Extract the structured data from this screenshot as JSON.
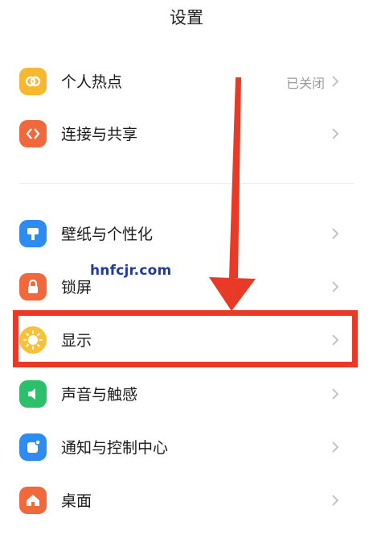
{
  "header": {
    "title": "设置"
  },
  "items": [
    {
      "label": "个人热点",
      "value": "已关闭",
      "icon": "hotspot-icon",
      "color": "#F7B731"
    },
    {
      "label": "连接与共享",
      "icon": "share-icon",
      "color": "#F0683C"
    },
    {
      "label": "壁纸与个性化",
      "icon": "wallpaper-icon",
      "color": "#2E8BF0"
    },
    {
      "label": "锁屏",
      "icon": "lock-icon",
      "color": "#F0683C"
    },
    {
      "label": "显示",
      "icon": "sun-icon",
      "color": "#F7C23A"
    },
    {
      "label": "声音与触感",
      "icon": "speaker-icon",
      "color": "#2DC06B"
    },
    {
      "label": "通知与控制中心",
      "icon": "notification-icon",
      "color": "#2E8BF0"
    },
    {
      "label": "桌面",
      "icon": "home-icon",
      "color": "#F0683C"
    }
  ],
  "watermark": "hnfcjr.com",
  "annotation_color": "#E83A26"
}
